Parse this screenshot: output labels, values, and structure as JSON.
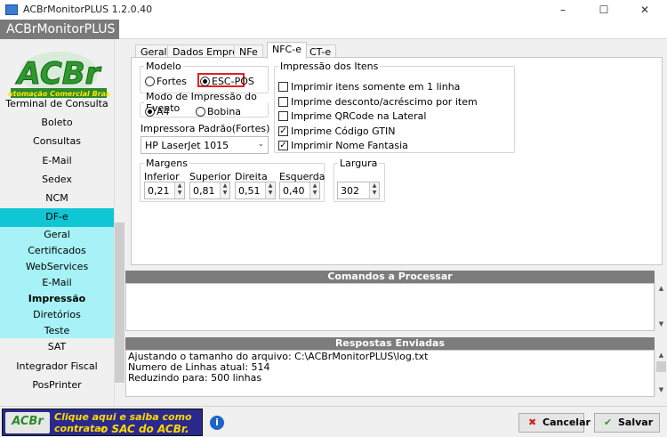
{
  "window": {
    "title": "ACBrMonitorPLUS 1.2.0.40",
    "minimize_icon": "minimize-icon",
    "maximize_icon": "maximize-icon",
    "close_icon": "close-icon"
  },
  "app": {
    "title": "ACBrMonitorPLUS"
  },
  "logo": {
    "brand": "ACBr",
    "subtitle": "Automação Comercial Brasil"
  },
  "sidebar": {
    "items": [
      {
        "label": "Terminal de Consulta"
      },
      {
        "label": "Boleto"
      },
      {
        "label": "Consultas"
      },
      {
        "label": "E-Mail"
      },
      {
        "label": "Sedex"
      },
      {
        "label": "NCM"
      },
      {
        "label": "DF-e"
      },
      {
        "label": "Geral"
      },
      {
        "label": "Certificados"
      },
      {
        "label": "WebServices"
      },
      {
        "label": "E-Mail"
      },
      {
        "label": "Impressão"
      },
      {
        "label": "Diretórios"
      },
      {
        "label": "Teste"
      },
      {
        "label": "SAT"
      },
      {
        "label": "Integrador Fiscal"
      },
      {
        "label": "PosPrinter"
      }
    ]
  },
  "tabs": [
    {
      "label": "Geral"
    },
    {
      "label": "Dados Empresa"
    },
    {
      "label": "NFe"
    },
    {
      "label": "NFC-e"
    },
    {
      "label": "CT-e"
    }
  ],
  "nfce": {
    "modelo": {
      "legend": "Modelo",
      "option1": "Fortes",
      "option2": "ESC-POS",
      "selected": "ESC-POS"
    },
    "modo": {
      "legend": "Modo de Impressão do Evento",
      "option1": "A4",
      "option2": "Bobina",
      "selected": "A4"
    },
    "impressora": {
      "label": "Impressora Padrão(Fortes)",
      "value": "HP LaserJet 1015"
    },
    "itens": {
      "legend": "Impressão dos Itens",
      "options": [
        {
          "label": "Imprimir itens somente em 1 linha",
          "checked": false
        },
        {
          "label": "Imprime desconto/acréscimo por item",
          "checked": false
        },
        {
          "label": "Imprime QRCode na Lateral",
          "checked": false
        },
        {
          "label": "Imprime Código GTIN",
          "checked": true
        },
        {
          "label": "Imprimir Nome Fantasia",
          "checked": true
        }
      ]
    },
    "margens": {
      "legend": "Margens",
      "inferior_label": "Inferior",
      "inferior": "0,21",
      "superior_label": "Superior",
      "superior": "0,81",
      "direita_label": "Direita",
      "direita": "0,51",
      "esquerda_label": "Esquerda",
      "esquerda": "0,40"
    },
    "largura": {
      "legend": "Largura",
      "value": "302"
    }
  },
  "comandos": {
    "title": "Comandos a Processar"
  },
  "respostas": {
    "title": "Respostas Enviadas",
    "lines": [
      "Ajustando o tamanho do arquivo: C:\\ACBrMonitorPLUS\\log.txt",
      "Numero de Linhas atual: 514",
      "Reduzindo para: 500 linhas"
    ]
  },
  "footer": {
    "banner_line1": "Clique aqui e saiba como contratar",
    "banner_line2": "o SAC do ACBr.",
    "banner_logo": "ACBr",
    "cancel_label": "Cancelar",
    "save_label": "Salvar"
  },
  "colors": {
    "accent_cyan": "#11c6d4",
    "light_cyan": "#a6f2f6",
    "header_gray": "#7a7a7a",
    "highlight_red": "#e02020"
  }
}
